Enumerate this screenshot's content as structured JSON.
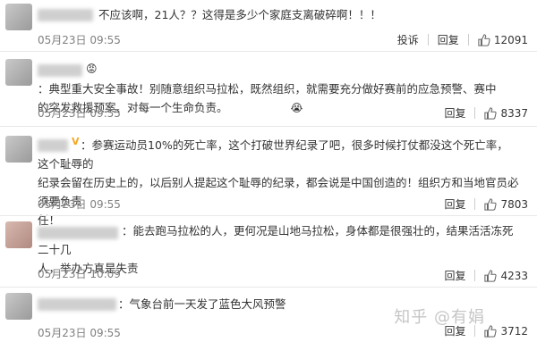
{
  "comments": [
    {
      "text": "不应该啊，21人？？这得是多少个家庭支离破碎啊！！！",
      "time": "05月23日 09:55",
      "report": "投诉",
      "reply": "回复",
      "likes": "12091"
    },
    {
      "badge": "😡",
      "text": "：典型重大安全事故！别随意组织马拉松，既然组织，就需要充分做好赛前的应急预警、赛中\n的突发救援预案、对每一个生命负责。",
      "emoji": "😭",
      "time": "05月23日 09:55",
      "reply": "回复",
      "likes": "8337"
    },
    {
      "badge": "V",
      "text": "：参赛运动员10%的死亡率，这个打破世界纪录了吧，很多时候打仗都没这个死亡率，这个耻辱的\n纪录会留在历史上的，以后别人提起这个耻辱的纪录，都会说是中国创造的！组织方和当地官员必须要负责\n任！",
      "time": "05月23日 09:55",
      "reply": "回复",
      "likes": "7803"
    },
    {
      "text": "：能去跑马拉松的人，更何况是山地马拉松，身体都是很强壮的，结果活活冻死二十几\n人，举办方真是失责",
      "time": "05月23日 10:09",
      "reply": "回复",
      "likes": "4233"
    },
    {
      "text": "：气象台前一天发了蓝色大风预警",
      "time": "05月23日 09:55",
      "reply": "回复",
      "likes": "3712"
    }
  ],
  "watermark": "知乎 @有娟"
}
